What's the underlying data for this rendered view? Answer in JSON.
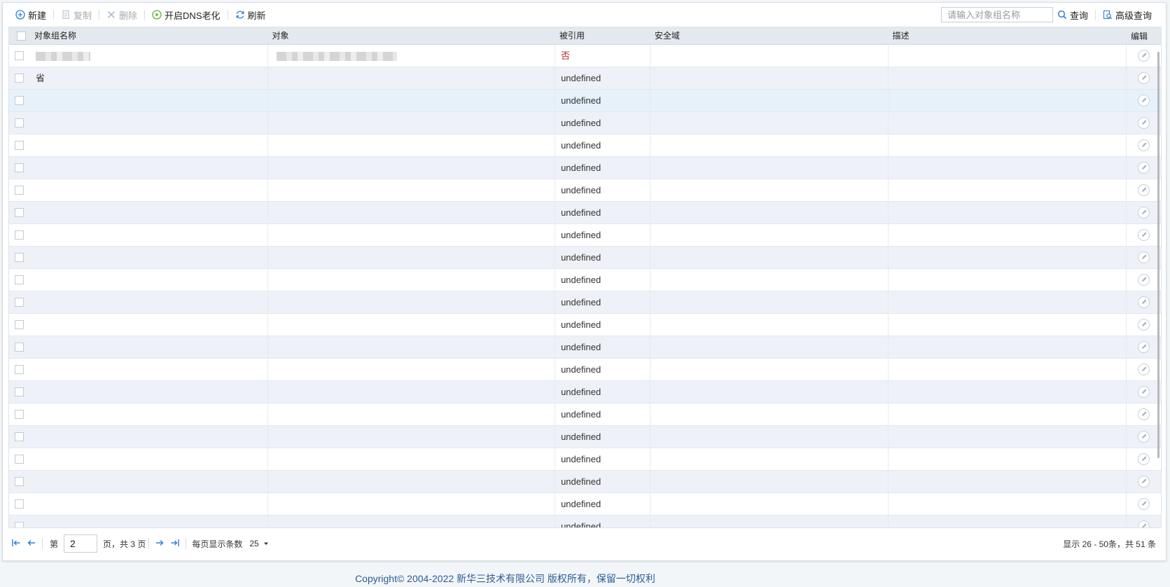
{
  "toolbar": {
    "new_label": "新建",
    "copy_label": "复制",
    "delete_label": "删除",
    "dns_label": "开启DNS老化",
    "refresh_label": "刷新",
    "search_placeholder": "请输入对象组名称",
    "query_label": "查询",
    "advanced_label": "高级查询"
  },
  "table": {
    "columns": [
      "对象组名称",
      "对象",
      "被引用",
      "安全域",
      "描述",
      "编辑"
    ],
    "rows": [
      {
        "name": "",
        "object": "",
        "ref": "否",
        "zone": "",
        "desc": "",
        "blurred": true
      },
      {
        "name": "省",
        "object": "",
        "ref": "undefined",
        "zone": "",
        "desc": ""
      },
      {
        "name": "",
        "object": "",
        "ref": "undefined",
        "zone": "",
        "desc": ""
      },
      {
        "name": "",
        "object": "",
        "ref": "undefined",
        "zone": "",
        "desc": ""
      },
      {
        "name": "",
        "object": "",
        "ref": "undefined",
        "zone": "",
        "desc": ""
      },
      {
        "name": "",
        "object": "",
        "ref": "undefined",
        "zone": "",
        "desc": ""
      },
      {
        "name": "",
        "object": "",
        "ref": "undefined",
        "zone": "",
        "desc": ""
      },
      {
        "name": "",
        "object": "",
        "ref": "undefined",
        "zone": "",
        "desc": ""
      },
      {
        "name": "",
        "object": "",
        "ref": "undefined",
        "zone": "",
        "desc": ""
      },
      {
        "name": "",
        "object": "",
        "ref": "undefined",
        "zone": "",
        "desc": ""
      },
      {
        "name": "",
        "object": "",
        "ref": "undefined",
        "zone": "",
        "desc": ""
      },
      {
        "name": "",
        "object": "",
        "ref": "undefined",
        "zone": "",
        "desc": ""
      },
      {
        "name": "",
        "object": "",
        "ref": "undefined",
        "zone": "",
        "desc": ""
      },
      {
        "name": "",
        "object": "",
        "ref": "undefined",
        "zone": "",
        "desc": ""
      },
      {
        "name": "",
        "object": "",
        "ref": "undefined",
        "zone": "",
        "desc": ""
      },
      {
        "name": "",
        "object": "",
        "ref": "undefined",
        "zone": "",
        "desc": ""
      },
      {
        "name": "",
        "object": "",
        "ref": "undefined",
        "zone": "",
        "desc": ""
      },
      {
        "name": "",
        "object": "",
        "ref": "undefined",
        "zone": "",
        "desc": ""
      },
      {
        "name": "",
        "object": "",
        "ref": "undefined",
        "zone": "",
        "desc": ""
      },
      {
        "name": "",
        "object": "",
        "ref": "undefined",
        "zone": "",
        "desc": ""
      },
      {
        "name": "",
        "object": "",
        "ref": "undefined",
        "zone": "",
        "desc": ""
      },
      {
        "name": "",
        "object": "",
        "ref": "undefined",
        "zone": "",
        "desc": ""
      }
    ]
  },
  "pager": {
    "page_prefix": "第",
    "current_page": "2",
    "page_suffix": "页，共 3 页",
    "page_size_label": "每页显示条数",
    "page_size": "25",
    "summary": "显示 26 - 50条，共 51 条"
  },
  "footer": {
    "copyright": "Copyright© 2004-2022 新华三技术有限公司 版权所有，保留一切权利"
  },
  "colors": {
    "accent": "#2f7ed8",
    "ref_no": "#c0292b",
    "dns_green": "#5cb531"
  }
}
